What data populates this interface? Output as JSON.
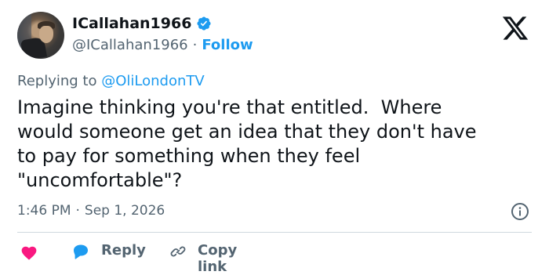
{
  "author": {
    "display_name": "ICallahan1966",
    "handle": "@ICallahan1966",
    "separator": "·",
    "follow_label": "Follow",
    "verified": true
  },
  "reply_context": {
    "prefix": "Replying to",
    "mention": "@OliLondonTV"
  },
  "tweet": {
    "text": "Imagine thinking you're that entitled.  Where\nwould someone get an idea that they don't have\nto pay for something when they feel\n\"uncomfortable\"?"
  },
  "meta": {
    "time": "1:46 PM",
    "separator": "·",
    "date": "Sep 1, 2026"
  },
  "actions": {
    "reply_label": "Reply",
    "copy_link_label": "Copy link"
  },
  "icons": {
    "verified": "verified-badge-icon",
    "logo": "x-logo-icon",
    "info": "info-icon",
    "like": "heart-icon",
    "reply": "reply-bubble-icon",
    "link": "link-icon"
  },
  "colors": {
    "accent": "#1d9bf0",
    "like": "#f91880",
    "text": "#0f1419",
    "secondary": "#536471"
  }
}
